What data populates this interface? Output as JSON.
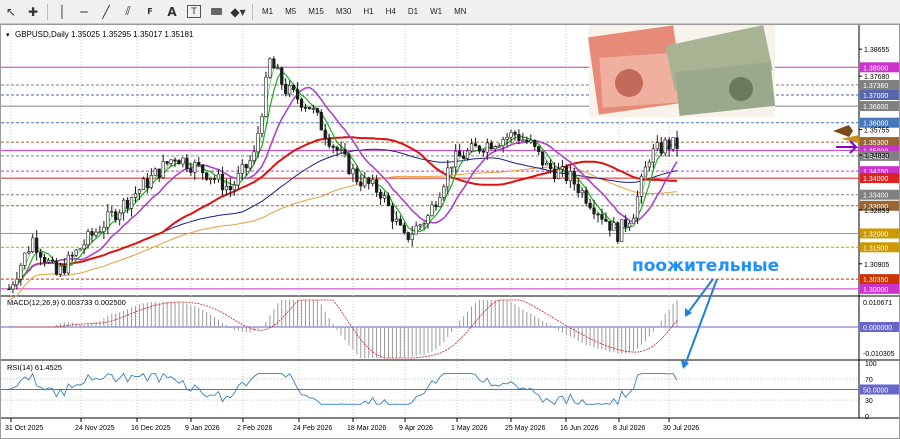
{
  "toolbar": {
    "icons": [
      "cursor-icon",
      "crosshair-icon",
      "vertical-line-icon",
      "horizontal-line-icon",
      "trendline-icon",
      "channel-icon",
      "fibonacci-icon",
      "text-icon",
      "text-label-icon",
      "rectangle-icon",
      "shapes-icon"
    ],
    "timeframes": [
      "M1",
      "M5",
      "M15",
      "M30",
      "H1",
      "H4",
      "D1",
      "W1",
      "MN"
    ]
  },
  "chart": {
    "header": "GBPUSD,Daily  1.35025 1.35295 1.35017 1.35181",
    "symbol": "GBPUSD",
    "timeframe": "Daily",
    "ohlc": [
      "1.35025",
      "1.35295",
      "1.35017",
      "1.35181"
    ]
  },
  "price_axis": {
    "plain_ticks": [
      "1.38655",
      "1.37680",
      "1.35755",
      "1.34830",
      "1.32853",
      "1.30905"
    ],
    "levels": [
      {
        "label": "1.38000",
        "value": 1.38,
        "color": "#cc33cc"
      },
      {
        "label": "1.37360",
        "value": 1.3736,
        "color": "#808080"
      },
      {
        "label": "1.37000",
        "value": 1.37,
        "color": "#5566aa"
      },
      {
        "label": "1.36600",
        "value": 1.366,
        "color": "#808080"
      },
      {
        "label": "1.36000",
        "value": 1.36,
        "color": "#4477bb"
      },
      {
        "label": "1.35300",
        "value": 1.353,
        "color": "#996633"
      },
      {
        "label": "1.35000",
        "value": 1.35,
        "color": "#cc33cc"
      },
      {
        "label": "1.34800",
        "value": 1.348,
        "color": "#808080"
      },
      {
        "label": "1.34250",
        "value": 1.3425,
        "color": "#cc33cc"
      },
      {
        "label": "1.34000",
        "value": 1.34,
        "color": "#dd2222"
      },
      {
        "label": "1.33400",
        "value": 1.334,
        "color": "#808080"
      },
      {
        "label": "1.33000",
        "value": 1.33,
        "color": "#996633"
      },
      {
        "label": "1.32000",
        "value": 1.32,
        "color": "#cc9900"
      },
      {
        "label": "1.31500",
        "value": 1.315,
        "color": "#cc9900"
      },
      {
        "label": "1.30350",
        "value": 1.3035,
        "color": "#cc3300"
      },
      {
        "label": "1.30000",
        "value": 1.3,
        "color": "#cc33cc"
      }
    ]
  },
  "macd": {
    "label": "MACD(12,26,9) 0.003733 0.002500",
    "ticks": [
      "0.010671",
      "0.000000",
      "-0.010305"
    ]
  },
  "rsi": {
    "label": "RSI(14) 61.4525",
    "ticks": [
      "100",
      "70",
      "50.0000",
      "30",
      "0"
    ]
  },
  "time_axis": [
    "31 Oct 2025",
    "24 Nov 2025",
    "16 Dec 2025",
    "9 Jan 2026",
    "2 Feb 2026",
    "24 Feb 2026",
    "18 Mar 2026",
    "9 Apr 2026",
    "1 May 2026",
    "25 May 2026",
    "16 Jun 2026",
    "8 Jul 2026",
    "30 Jul 2026"
  ],
  "annotation": "поожительные",
  "image": {
    "description": "banknotes-image"
  },
  "colors": {
    "bull": "#1a1a1a",
    "bear": "#1a1a1a",
    "ma_red": "#dd1111",
    "ma_purple": "#aa44cc",
    "ma_green": "#22aa22",
    "ma_blue": "#1a237e",
    "ma_orange": "#e6a040",
    "rsi": "#3a7fc0",
    "arrow": "#2080e0"
  }
}
